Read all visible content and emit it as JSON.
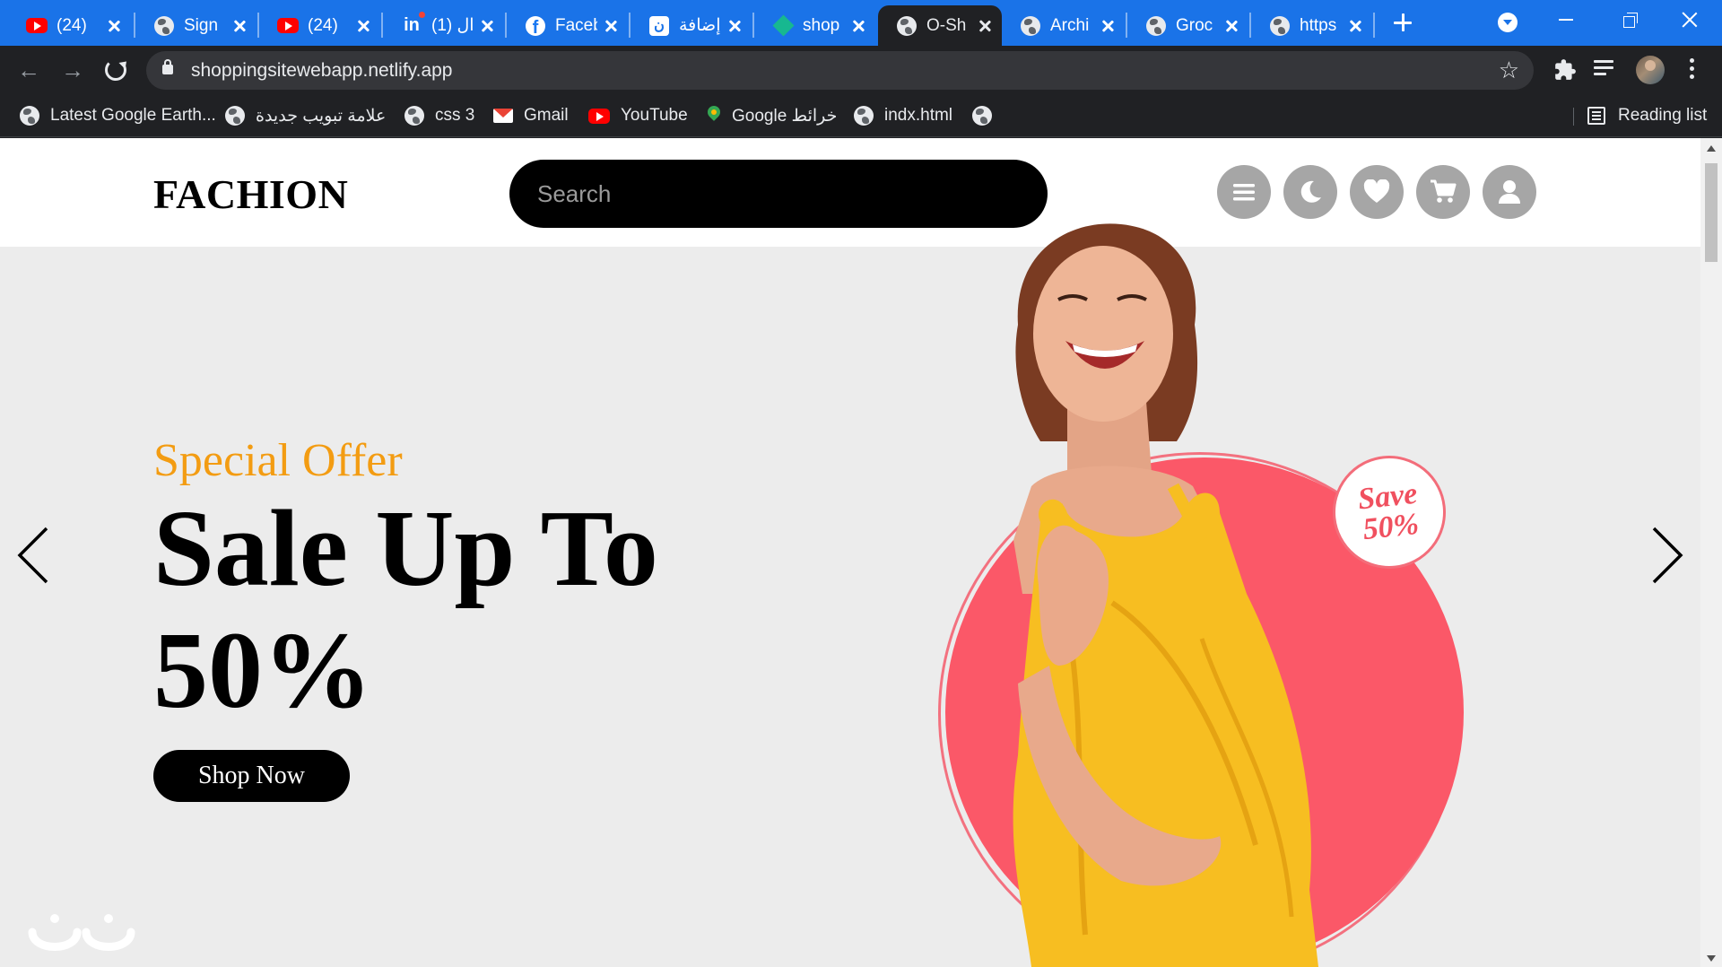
{
  "browser": {
    "tabs": [
      {
        "icon": "youtube-icon",
        "title": "(24)"
      },
      {
        "icon": "globe-icon",
        "title": "Sign"
      },
      {
        "icon": "youtube-icon",
        "title": "(24)"
      },
      {
        "icon": "linkedin-icon",
        "title": "(1) ال"
      },
      {
        "icon": "facebook-icon",
        "title": "Faceb"
      },
      {
        "icon": "arabic-site-icon",
        "title": "إضافة"
      },
      {
        "icon": "diamond-icon",
        "title": "shop"
      },
      {
        "icon": "globe-icon",
        "title": "O-Sh",
        "active": true
      },
      {
        "icon": "globe-icon",
        "title": "Archi"
      },
      {
        "icon": "globe-icon",
        "title": "Groc"
      },
      {
        "icon": "globe-icon",
        "title": "https"
      }
    ],
    "url": "shoppingsitewebapp.netlify.app",
    "bookmarks": [
      {
        "icon": "globe-icon",
        "label": "Latest Google Earth..."
      },
      {
        "icon": "globe-icon",
        "label": "علامة تبويب جديدة"
      },
      {
        "icon": "globe-icon",
        "label": "css 3"
      },
      {
        "icon": "gmail-icon",
        "label": "Gmail"
      },
      {
        "icon": "youtube-icon",
        "label": "YouTube"
      },
      {
        "icon": "maps-icon",
        "label": "Google خرائط"
      },
      {
        "icon": "globe-icon",
        "label": "indx.html"
      },
      {
        "icon": "globe-icon",
        "label": ""
      }
    ],
    "reading_list_label": "Reading list",
    "accent_color": "#1a73e8"
  },
  "site": {
    "logo": "FACHION",
    "search_placeholder": "Search",
    "header_icons": [
      "menu-icon",
      "moon-icon",
      "heart-icon",
      "cart-icon",
      "user-icon"
    ],
    "hero": {
      "subtitle": "Special Offer",
      "title": "Sale Up To 50%",
      "button": "Shop Now",
      "badge_line1": "Save",
      "badge_line2": "50%",
      "subtitle_color": "#f39c12",
      "circle_color": "#fb5868"
    }
  }
}
